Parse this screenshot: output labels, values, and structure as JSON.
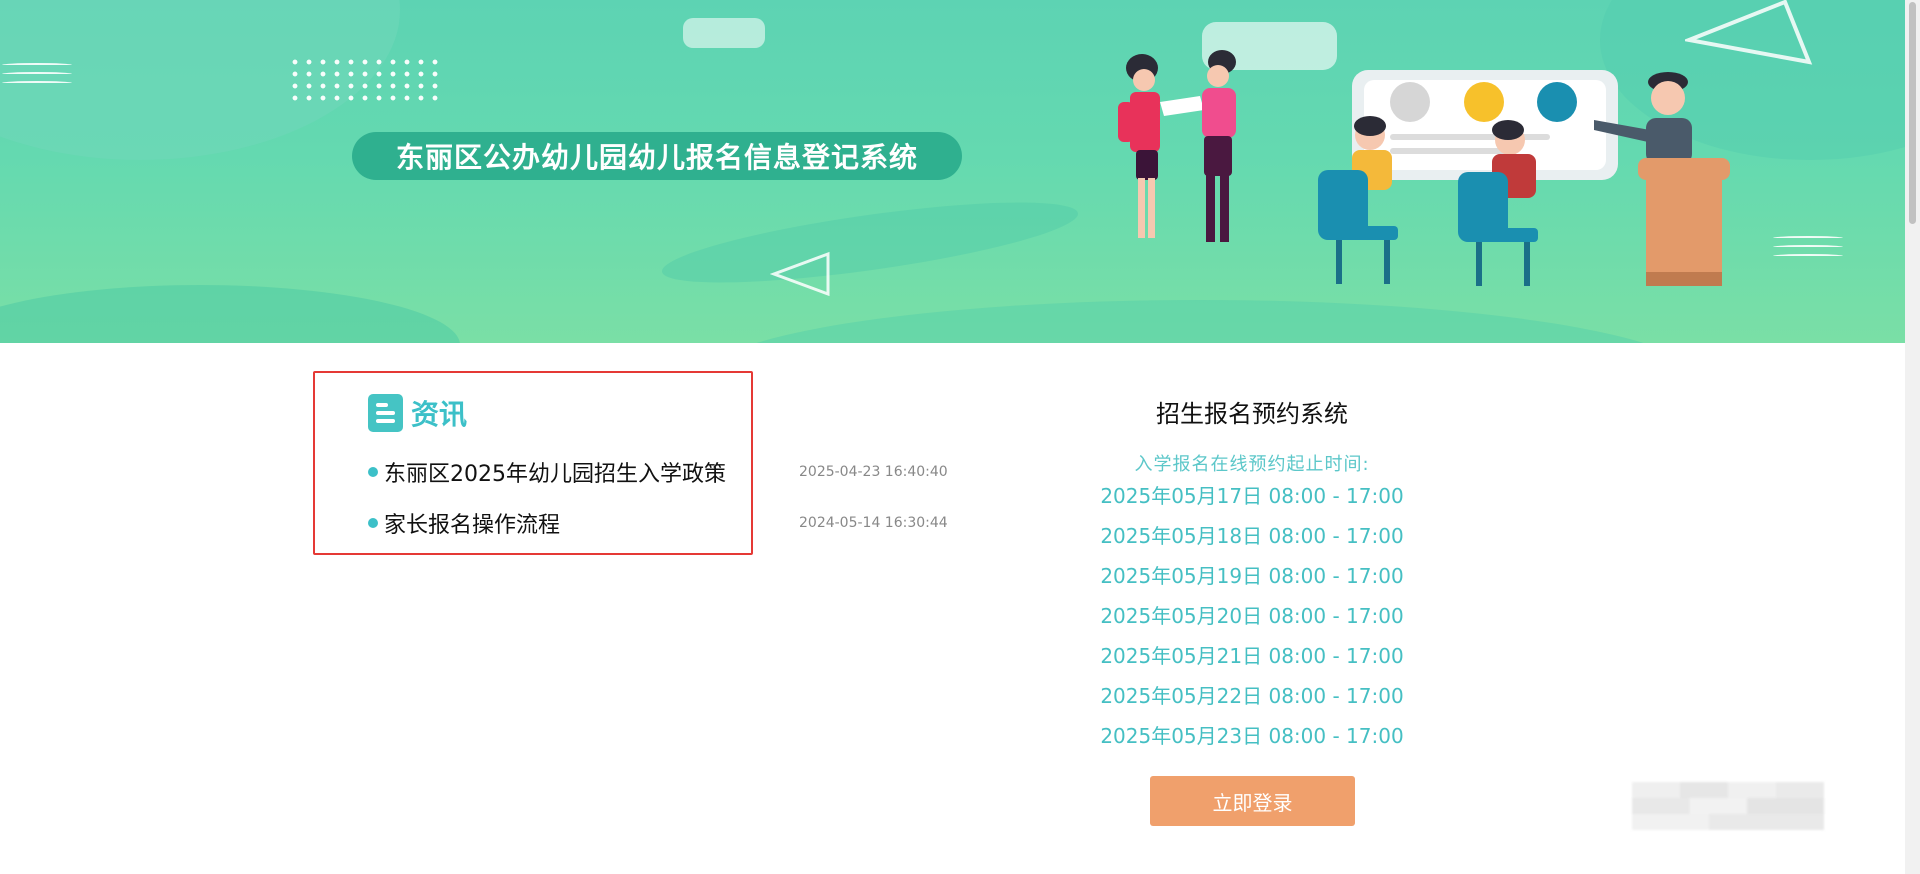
{
  "banner": {
    "title": "东丽区公办幼儿园幼儿报名信息登记系统"
  },
  "news": {
    "heading": "资讯",
    "items": [
      {
        "title": "东丽区2025年幼儿园招生入学政策",
        "date": "2025-04-23 16:40:40"
      },
      {
        "title": "家长报名操作流程",
        "date": "2024-05-14 16:30:44"
      }
    ]
  },
  "registration": {
    "title": "招生报名预约系统",
    "subtitle": "入学报名在线预约起止时间:",
    "schedule": [
      "2025年05月17日 08:00 - 17:00",
      "2025年05月18日 08:00 - 17:00",
      "2025年05月19日 08:00 - 17:00",
      "2025年05月20日 08:00 - 17:00",
      "2025年05月21日 08:00 - 17:00",
      "2025年05月22日 08:00 - 17:00",
      "2025年05月23日 08:00 - 17:00"
    ],
    "login_label": "立即登录"
  },
  "colors": {
    "accent": "#3cc0c8",
    "button": "#f0a06c",
    "banner": "#5dd3b3",
    "highlight_frame": "#e53935"
  }
}
